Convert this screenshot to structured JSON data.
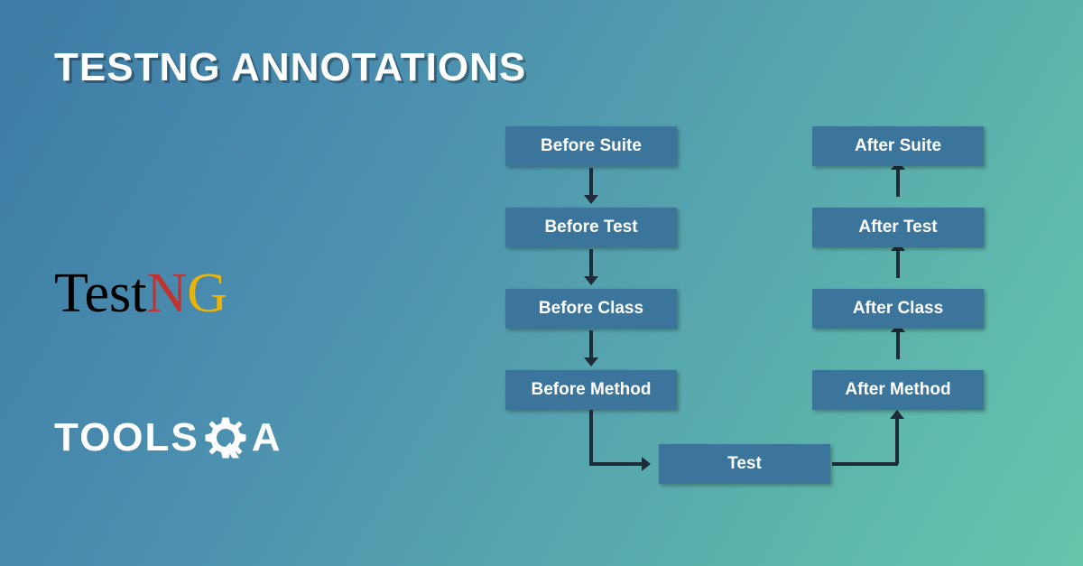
{
  "title": "TESTNG ANNOTATIONS",
  "logos": {
    "testng": {
      "part1": "Test",
      "part2": "N",
      "part3": "G"
    },
    "toolsqa": {
      "pre": "TOOLS",
      "post": "A"
    }
  },
  "chart_data": {
    "type": "flow-diagram",
    "before_nodes": [
      "Before Suite",
      "Before Test",
      "Before Class",
      "Before Method"
    ],
    "center_node": "Test",
    "after_nodes": [
      "After Method",
      "After Class",
      "After Test",
      "After Suite"
    ],
    "flow": "Before Suite → Before Test → Before Class → Before Method → Test → After Method → After Class → After Test → After Suite"
  }
}
